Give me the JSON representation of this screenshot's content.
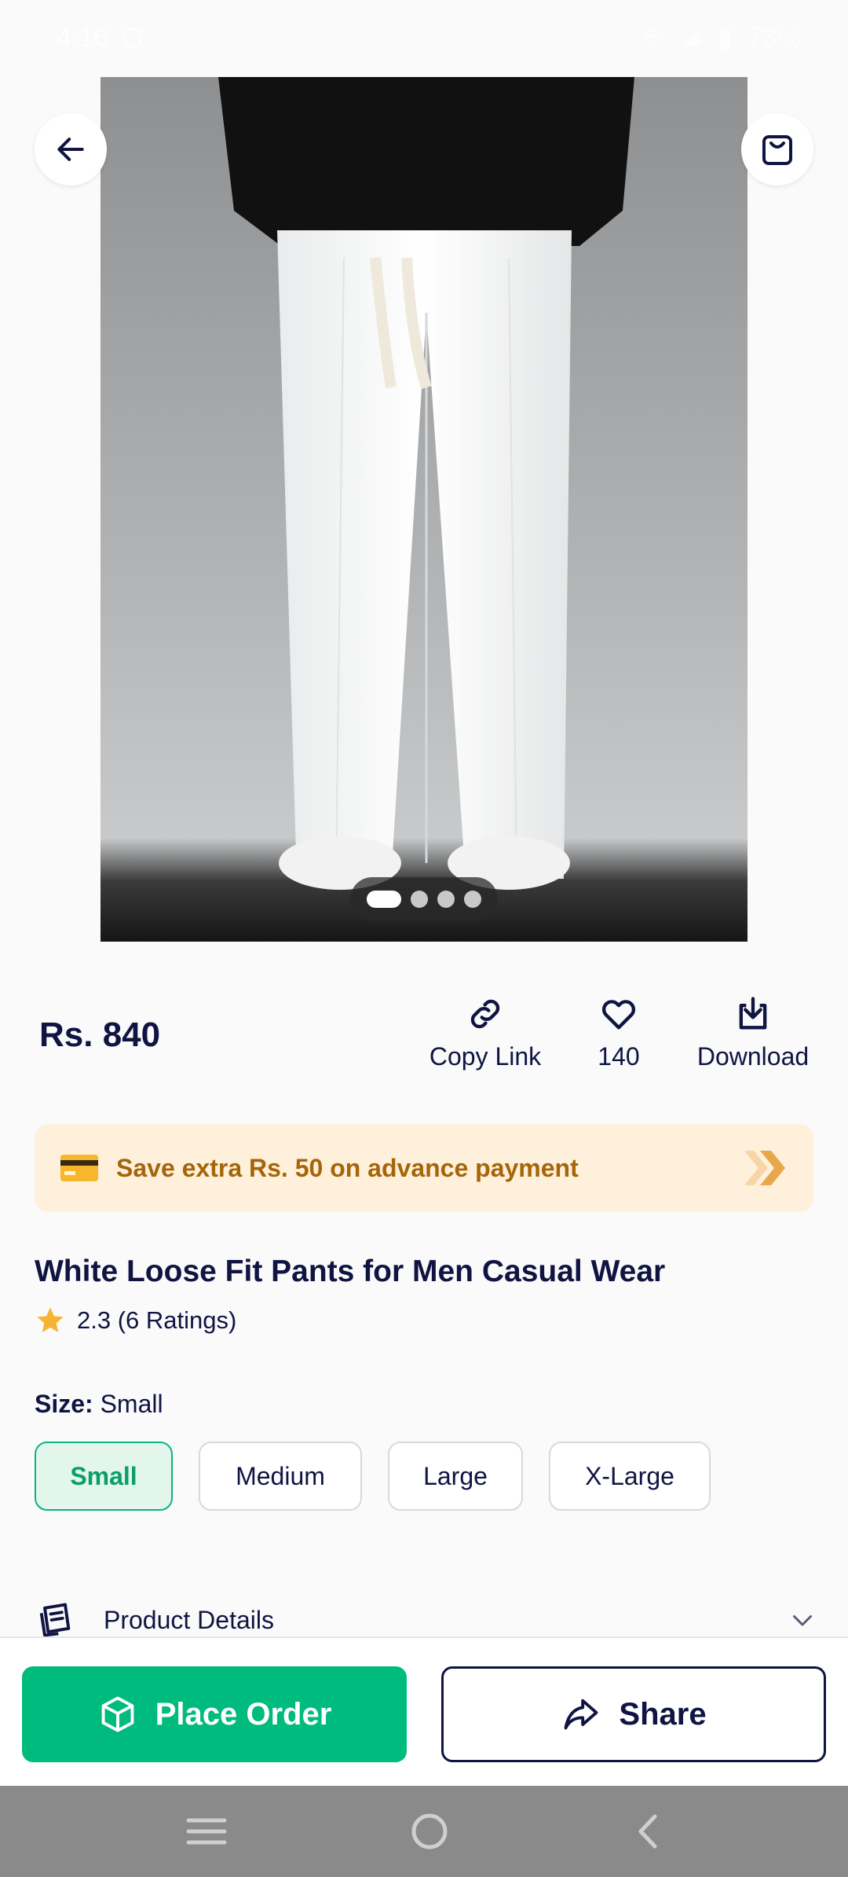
{
  "status_bar": {
    "time": "4:16",
    "battery": "73%"
  },
  "product": {
    "price": "Rs. 840",
    "title": "White Loose Fit Pants for Men Casual Wear",
    "rating_text": "2.3 (6 Ratings)",
    "image_count": 4,
    "active_image_index": 0
  },
  "actions": {
    "copy_link_label": "Copy Link",
    "like_count": "140",
    "download_label": "Download"
  },
  "promo": {
    "text": "Save extra Rs. 50 on advance payment"
  },
  "size": {
    "label": "Size:",
    "selected": "Small",
    "options": [
      "Small",
      "Medium",
      "Large",
      "X-Large"
    ]
  },
  "details": {
    "label": "Product Details"
  },
  "buttons": {
    "place_order": "Place Order",
    "share": "Share"
  },
  "colors": {
    "brand_green": "#00bb7e",
    "navy": "#0f1442",
    "promo_bg": "#fff0db",
    "promo_text": "#a56508",
    "star": "#f5b431"
  },
  "icons": [
    "back-arrow-icon",
    "cart-icon",
    "link-icon",
    "heart-icon",
    "download-icon",
    "card-icon",
    "chevron-right-double-icon",
    "star-icon",
    "details-icon",
    "chevron-down-icon",
    "box-icon",
    "share-icon",
    "menu-icon",
    "home-icon",
    "back-nav-icon"
  ]
}
